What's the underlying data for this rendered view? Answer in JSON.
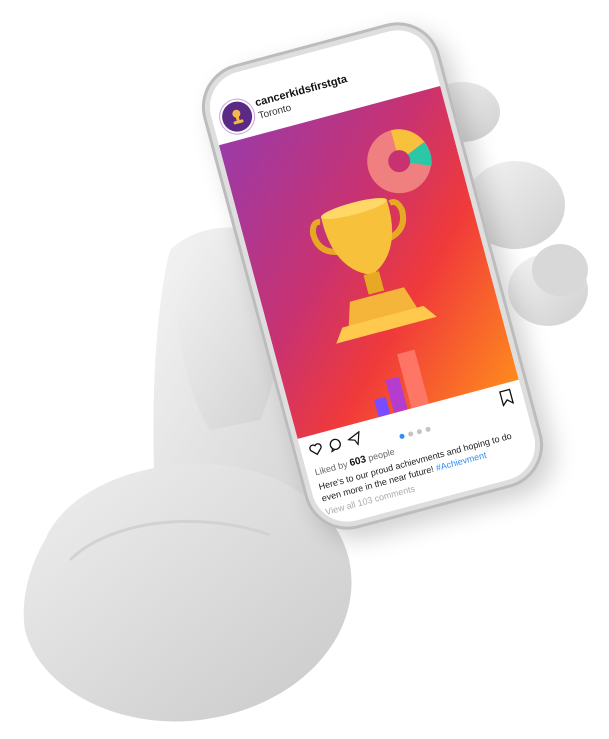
{
  "post": {
    "username": "cancerkidsfirstgta",
    "location": "Toronto",
    "likes_prefix": "Liked by",
    "likes_count": "603",
    "likes_suffix": "people",
    "caption_text": "Here's to our proud achievments and hoping to do even more in the near future! ",
    "hashtag": "#Achievment",
    "comments_link": "View all 103 comments",
    "carousel": {
      "total": 4,
      "active": 1
    }
  },
  "icons": {
    "avatar": "organization-logo-icon",
    "image_content": [
      "trophy-icon",
      "pie-chart-icon",
      "bar-chart-icon"
    ],
    "actions": [
      "heart-icon",
      "comment-icon",
      "share-icon",
      "bookmark-icon"
    ]
  },
  "colors": {
    "accent_blue": "#2f8ef0",
    "gradient": [
      "#9b3aa8",
      "#c93270",
      "#f03a3a",
      "#ff8a1e"
    ],
    "trophy_gold": "#f7c13c"
  }
}
